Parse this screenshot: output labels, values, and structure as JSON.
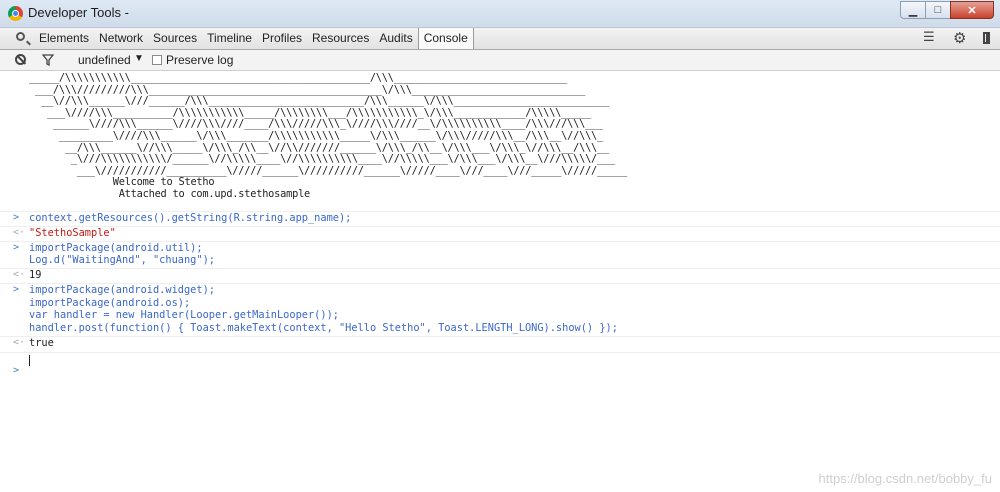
{
  "window": {
    "title": "Developer Tools -"
  },
  "tabs": [
    "Elements",
    "Network",
    "Sources",
    "Timeline",
    "Profiles",
    "Resources",
    "Audits",
    "Console"
  ],
  "active_tab": "Console",
  "console_toolbar": {
    "context": "undefined",
    "preserve_log": "Preserve log"
  },
  "banner": {
    "art": [
      "_____/\\\\\\\\\\\\\\\\\\\\\\________________________________________/\\\\\\_____________________________",
      " ___/\\\\\\/////////\\\\\\_______________________________________\\/\\\\\\_____________________________",
      "  __\\//\\\\\\______\\///______/\\\\\\__________________________/\\\\\\______\\/\\\\\\__________________________",
      "   ___\\////\\\\\\__________/\\\\\\\\\\\\\\\\\\\\\\_____/\\\\\\\\\\\\\\\\___/\\\\\\\\\\\\\\\\\\\\\\_\\/\\\\\\____________/\\\\\\\\\\_____",
      "    ______\\////\\\\\\______\\////\\\\\\////____/\\\\\\/////\\\\\\_\\////\\\\\\////__\\/\\\\\\\\\\\\\\\\\\\\____/\\\\\\///\\\\\\___",
      "     _________\\////\\\\\\______\\/\\\\\\_______/\\\\\\\\\\\\\\\\\\\\\\_____\\/\\\\\\______\\/\\\\\\/////\\\\\\__/\\\\\\__\\//\\\\\\_",
      "      __/\\\\\\______\\//\\\\\\_____\\/\\\\\\_/\\\\__\\//\\\\///////______\\/\\\\\\_/\\\\__\\/\\\\\\___\\/\\\\\\_\\//\\\\\\__/\\\\\\__",
      "       _\\///\\\\\\\\\\\\\\\\\\\\\\/______\\//\\\\\\\\\\____\\//\\\\\\\\\\\\\\\\\\\\____\\//\\\\\\\\\\___\\/\\\\\\___\\/\\\\\\__\\///\\\\\\\\\\/___",
      "        ___\\///////////__________\\/////______\\//////////______\\/////____\\///____\\///_____\\/////_____",
      "              Welcome to Stetho",
      "               Attached to com.upd.stethosample"
    ]
  },
  "entries": [
    {
      "type": "input",
      "lines": [
        "context.getResources().getString(R.string.app_name);"
      ]
    },
    {
      "type": "result",
      "kind": "string",
      "lines": [
        "\"StethoSample\""
      ]
    },
    {
      "type": "input",
      "lines": [
        "importPackage(android.util);",
        "Log.d(\"WaitingAnd\", \"chuang\");"
      ]
    },
    {
      "type": "result",
      "kind": "plain",
      "lines": [
        "19"
      ]
    },
    {
      "type": "input",
      "lines": [
        "importPackage(android.widget);",
        "importPackage(android.os);",
        "var handler = new Handler(Looper.getMainLooper());",
        "handler.post(function() { Toast.makeText(context, \"Hello Stetho\", Toast.LENGTH_LONG).show() });"
      ]
    },
    {
      "type": "result",
      "kind": "plain",
      "lines": [
        "true"
      ]
    }
  ],
  "prompt_glyph": ">",
  "result_glyph": "<·",
  "watermark": "https://blog.csdn.net/bobby_fu"
}
